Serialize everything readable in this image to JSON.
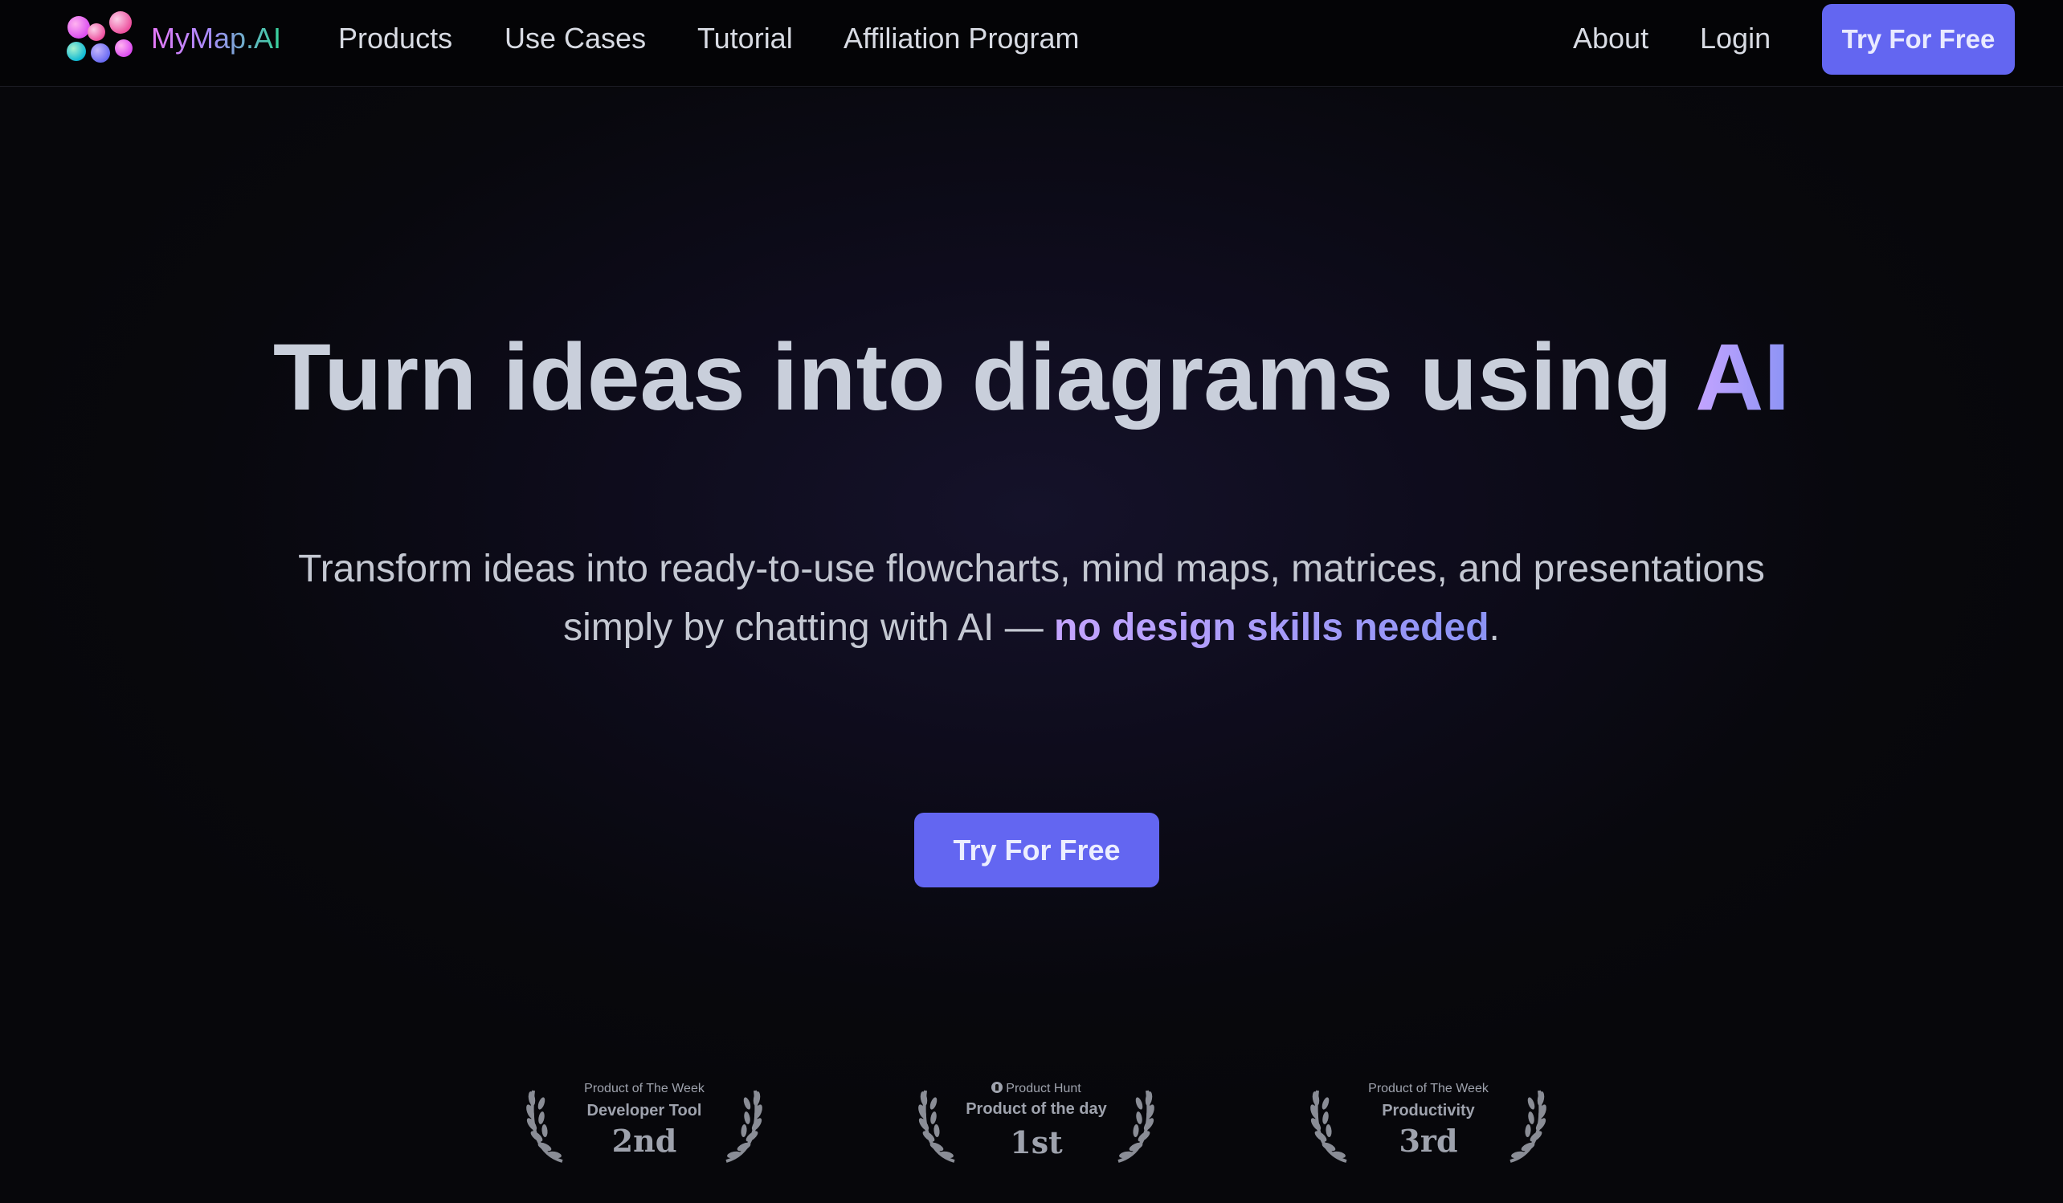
{
  "nav": {
    "brand": "MyMap.AI",
    "links": [
      "Products",
      "Use Cases",
      "Tutorial",
      "Affiliation Program"
    ],
    "right_links": [
      "About",
      "Login"
    ],
    "cta": "Try For Free"
  },
  "hero": {
    "title_main": "Turn ideas into diagrams using ",
    "title_accent": "AI",
    "subtitle_line1": "Transform ideas into ready-to-use flowcharts, mind maps, matrices, and presentations",
    "subtitle_line2": "simply by chatting with AI — ",
    "subtitle_accent": "no design skills needed",
    "subtitle_end": ".",
    "cta": "Try For Free"
  },
  "awards": [
    {
      "top": "Product of The Week",
      "title": "Developer Tool",
      "rank": "2nd"
    },
    {
      "top": "Product Hunt",
      "title": "Product of the day",
      "rank": "1st"
    },
    {
      "top": "Product of The Week",
      "title": "Productivity",
      "rank": "3rd"
    }
  ],
  "colors": {
    "background": "#07070b",
    "accent": "#6366f1",
    "gradient_start": "#c4a4ff",
    "gradient_end": "#8b93f5"
  },
  "icons": [
    "mymap-logo-icon",
    "laurel-left-icon",
    "laurel-right-icon",
    "product-hunt-icon"
  ]
}
